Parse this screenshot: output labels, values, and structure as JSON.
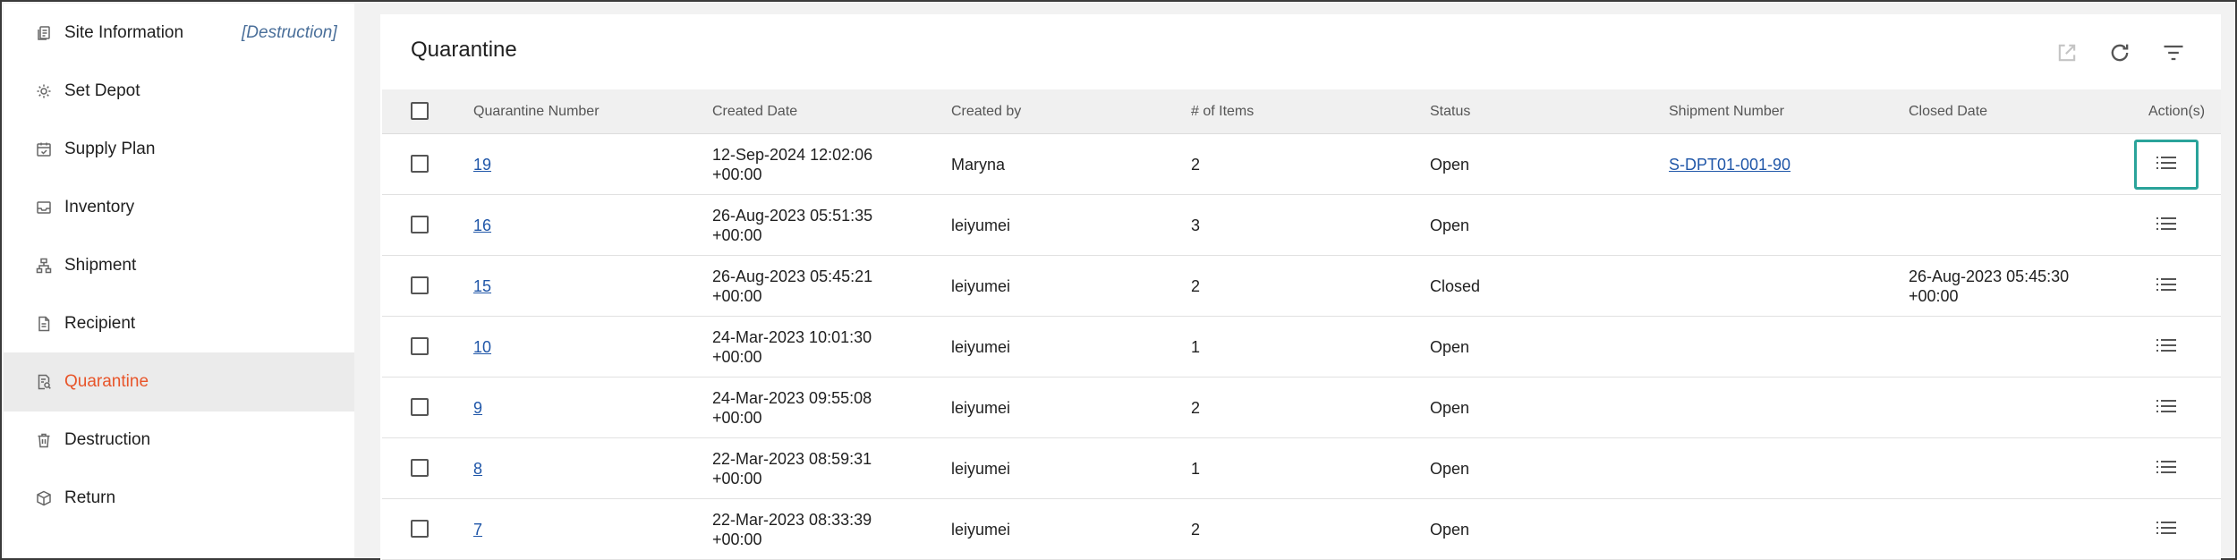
{
  "sidebar": {
    "items": [
      {
        "label": "Site Information",
        "tag": "[Destruction]",
        "icon": "document-copy-icon",
        "active": false
      },
      {
        "label": "Set Depot",
        "icon": "gear-icon",
        "active": false
      },
      {
        "label": "Supply Plan",
        "icon": "calendar-check-icon",
        "active": false
      },
      {
        "label": "Inventory",
        "icon": "inbox-icon",
        "active": false
      },
      {
        "label": "Shipment",
        "icon": "hierarchy-icon",
        "active": false
      },
      {
        "label": "Recipient",
        "icon": "document-icon",
        "active": false
      },
      {
        "label": "Quarantine",
        "icon": "document-search-icon",
        "active": true
      },
      {
        "label": "Destruction",
        "icon": "trash-icon",
        "active": false
      },
      {
        "label": "Return",
        "icon": "box-icon",
        "active": false
      }
    ]
  },
  "panel": {
    "title": "Quarantine",
    "tools": [
      "open-external-icon",
      "refresh-icon",
      "filter-icon"
    ]
  },
  "table": {
    "headers": {
      "quarantine_number": "Quarantine Number",
      "created_date": "Created Date",
      "created_by": "Created by",
      "items": "# of Items",
      "status": "Status",
      "shipment_number": "Shipment Number",
      "closed_date": "Closed Date",
      "actions": "Action(s)"
    },
    "rows": [
      {
        "number": "19",
        "created_date": "12-Sep-2024 12:02:06",
        "created_tz": "+00:00",
        "created_by": "Maryna",
        "items": "2",
        "status": "Open",
        "shipment": "S-DPT01-001-90",
        "closed_date": "",
        "closed_tz": ""
      },
      {
        "number": "16",
        "created_date": "26-Aug-2023 05:51:35",
        "created_tz": "+00:00",
        "created_by": "leiyumei",
        "items": "3",
        "status": "Open",
        "shipment": "",
        "closed_date": "",
        "closed_tz": ""
      },
      {
        "number": "15",
        "created_date": "26-Aug-2023 05:45:21",
        "created_tz": "+00:00",
        "created_by": "leiyumei",
        "items": "2",
        "status": "Closed",
        "shipment": "",
        "closed_date": "26-Aug-2023 05:45:30",
        "closed_tz": "+00:00"
      },
      {
        "number": "10",
        "created_date": "24-Mar-2023 10:01:30",
        "created_tz": "+00:00",
        "created_by": "leiyumei",
        "items": "1",
        "status": "Open",
        "shipment": "",
        "closed_date": "",
        "closed_tz": ""
      },
      {
        "number": "9",
        "created_date": "24-Mar-2023 09:55:08",
        "created_tz": "+00:00",
        "created_by": "leiyumei",
        "items": "2",
        "status": "Open",
        "shipment": "",
        "closed_date": "",
        "closed_tz": ""
      },
      {
        "number": "8",
        "created_date": "22-Mar-2023 08:59:31",
        "created_tz": "+00:00",
        "created_by": "leiyumei",
        "items": "1",
        "status": "Open",
        "shipment": "",
        "closed_date": "",
        "closed_tz": ""
      },
      {
        "number": "7",
        "created_date": "22-Mar-2023 08:33:39",
        "created_tz": "+00:00",
        "created_by": "leiyumei",
        "items": "2",
        "status": "Open",
        "shipment": "",
        "closed_date": "",
        "closed_tz": ""
      }
    ]
  },
  "colors": {
    "active_text": "#e8552a",
    "link": "#1f56a8",
    "focus_border": "#2aa39a"
  }
}
